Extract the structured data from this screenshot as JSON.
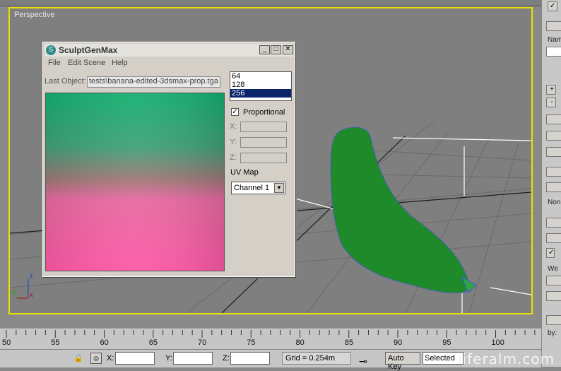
{
  "viewport": {
    "label": "Perspective"
  },
  "dialog": {
    "title": "SculptGenMax",
    "menu": [
      "File",
      "Edit Scene",
      "Help"
    ],
    "last_object_label": "Last Object:",
    "last_object_value": "tests\\banana-edited-3dsmax-prop.tga",
    "resolutions": [
      "64",
      "128",
      "256"
    ],
    "selected_resolution": "256",
    "proportional_label": "Proportional",
    "proportional_checked": true,
    "axes": [
      "X:",
      "Y:",
      "Z:"
    ],
    "uv_map_label": "UV Map",
    "channel_value": "Channel 1"
  },
  "timeline": {
    "ticks": [
      "50",
      "55",
      "60",
      "65",
      "70",
      "75",
      "80",
      "85",
      "90",
      "95",
      "100"
    ]
  },
  "statusbar": {
    "x_label": "X:",
    "y_label": "Y:",
    "z_label": "Z:",
    "grid_text": "Grid = 0.254m",
    "auto_key": "Auto Key",
    "selected": "Selected"
  },
  "right_panel": {
    "name_label": "Nam",
    "plus": "+",
    "minus": "-",
    "none_label": "Non",
    "we_label": "We",
    "by_label": "by:"
  },
  "watermark": "liferalm.com",
  "colors": {
    "viewport_border": "#e8e000",
    "selection": "#0a246a",
    "banana": "#1f8a2a",
    "vertex": "#4a4aff"
  }
}
